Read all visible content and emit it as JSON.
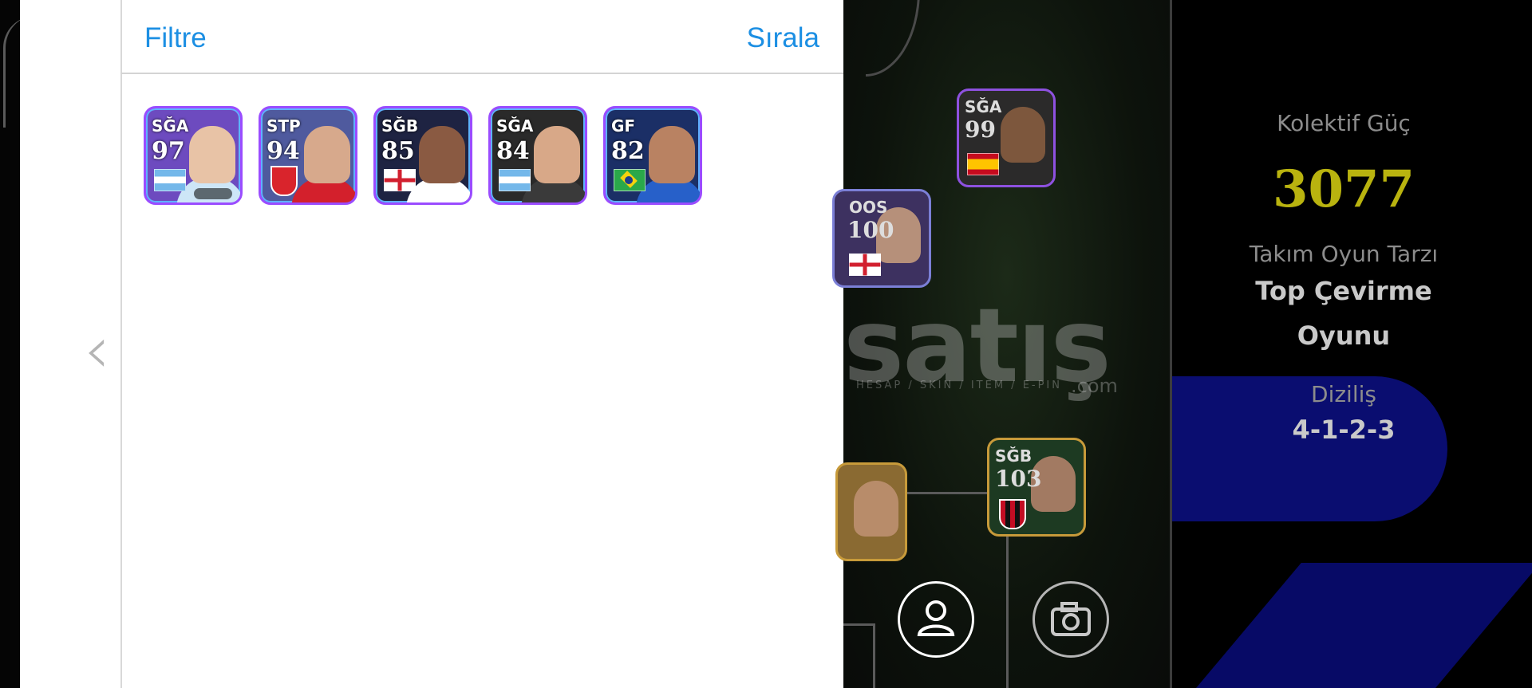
{
  "filter_panel": {
    "filter_label": "Filtre",
    "sort_label": "Sırala",
    "back_glyph": "‹",
    "cards": [
      {
        "position": "SĞA",
        "rating": "97",
        "nation_flag": "argentina",
        "bg": "#6d4bbf",
        "face": "#e8c3a6",
        "kit": "#cde6f7"
      },
      {
        "position": "STP",
        "rating": "94",
        "nation_flag": "arsenal-crest",
        "bg": "#4f5a9e",
        "face": "#d7a98c",
        "kit": "#d3202c"
      },
      {
        "position": "SĞB",
        "rating": "85",
        "nation_flag": "england",
        "bg": "#1e2342",
        "face": "#8a5a42",
        "kit": "#ffffff"
      },
      {
        "position": "SĞA",
        "rating": "84",
        "nation_flag": "argentina",
        "bg": "#2a2a2a",
        "face": "#d8a888",
        "kit": "#3a3a3a"
      },
      {
        "position": "GF",
        "rating": "82",
        "nation_flag": "brazil",
        "bg": "#1b2f66",
        "face": "#b98262",
        "kit": "#2760c9"
      }
    ]
  },
  "pitch": {
    "watermark_main": "satış",
    "watermark_sub": "HESAP / SKIN / ITEM / E-PIN",
    "watermark_com": ".com",
    "players": [
      {
        "position": "SĞA",
        "rating": "99",
        "flag": "spain",
        "border": "#8e51e0",
        "face": "#9e6e4e"
      },
      {
        "position": "OOS",
        "rating": "100",
        "flag": "england",
        "border": "#7b7fd6",
        "face": "#e4b89a"
      },
      {
        "position": "SĞB",
        "rating": "103",
        "flag": "milan",
        "border": "#c79a3a",
        "face": "#c79176"
      },
      {
        "position": "",
        "rating": "",
        "flag": "",
        "border": "#c79a3a",
        "face": "#d6a582"
      }
    ],
    "person_icon": "person-icon",
    "camera_icon": "camera-icon"
  },
  "stats": {
    "collective_label": "Kolektif Güç",
    "collective_value": "3077",
    "team_style_label": "Takım Oyun Tarzı",
    "team_style_value_line1": "Top Çevirme",
    "team_style_value_line2": "Oyunu",
    "formation_label": "Diziliş",
    "formation_value": "4-1-2-3",
    "accent_color": "#b9b30f"
  }
}
